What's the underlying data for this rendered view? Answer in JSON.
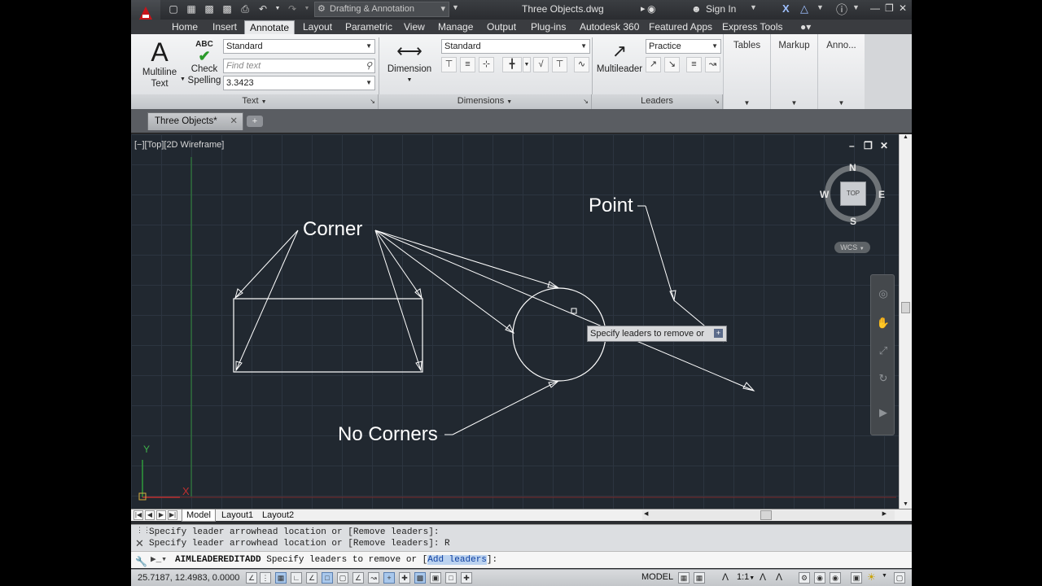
{
  "titlebar": {
    "workspace": "Drafting & Annotation",
    "doc_title": "Three Objects.dwg",
    "signin": "Sign In"
  },
  "tabs": [
    "Home",
    "Insert",
    "Annotate",
    "Layout",
    "Parametric",
    "View",
    "Manage",
    "Output",
    "Plug-ins",
    "Autodesk 360",
    "Featured Apps",
    "Express Tools"
  ],
  "active_tab": "Annotate",
  "ribbon": {
    "text_panel": {
      "multiline_label1": "Multiline",
      "multiline_label2": "Text",
      "check_label1": "Check",
      "check_label2": "Spelling",
      "abc": "ABC",
      "style": "Standard",
      "find_placeholder": "Find text",
      "height": "3.3423",
      "footer": "Text"
    },
    "dimensions_panel": {
      "dimension_label": "Dimension",
      "style": "Standard",
      "footer": "Dimensions"
    },
    "leaders_panel": {
      "multileader_label": "Multileader",
      "style": "Practice",
      "footer": "Leaders"
    },
    "tables_label": "Tables",
    "markup_label": "Markup",
    "anno_label": "Anno..."
  },
  "doc_tab": {
    "name": "Three Objects*"
  },
  "viewport": {
    "label": "[−][Top][2D Wireframe]",
    "corner_label": "Corner",
    "point_label": "Point",
    "no_corners_label": "No Corners",
    "tooltip": "Specify leaders to remove or",
    "tooltip_plus": "+",
    "axis_y": "Y",
    "axis_x": "X"
  },
  "viewcube": {
    "top": "TOP",
    "n": "N",
    "s": "S",
    "e": "E",
    "w": "W",
    "wcs": "WCS"
  },
  "layout_tabs": [
    "Model",
    "Layout1",
    "Layout2"
  ],
  "active_layout": "Model",
  "command": {
    "history1": "Specify leader arrowhead location or [Remove leaders]:",
    "history2": "Specify leader arrowhead location or [Remove leaders]: R",
    "current_cmd": "AIMLEADEREDITADD",
    "current_prompt_pre": "Specify leaders to remove or [",
    "current_option": "Add leaders",
    "current_prompt_post": "]:"
  },
  "status": {
    "coords": "25.7187, 12.4983, 0.0000",
    "model": "MODEL",
    "scale": "1:1"
  },
  "colors": {
    "canvas_bg": "#212830",
    "geometry": "#ffffff",
    "accent_red": "#c8141a"
  }
}
